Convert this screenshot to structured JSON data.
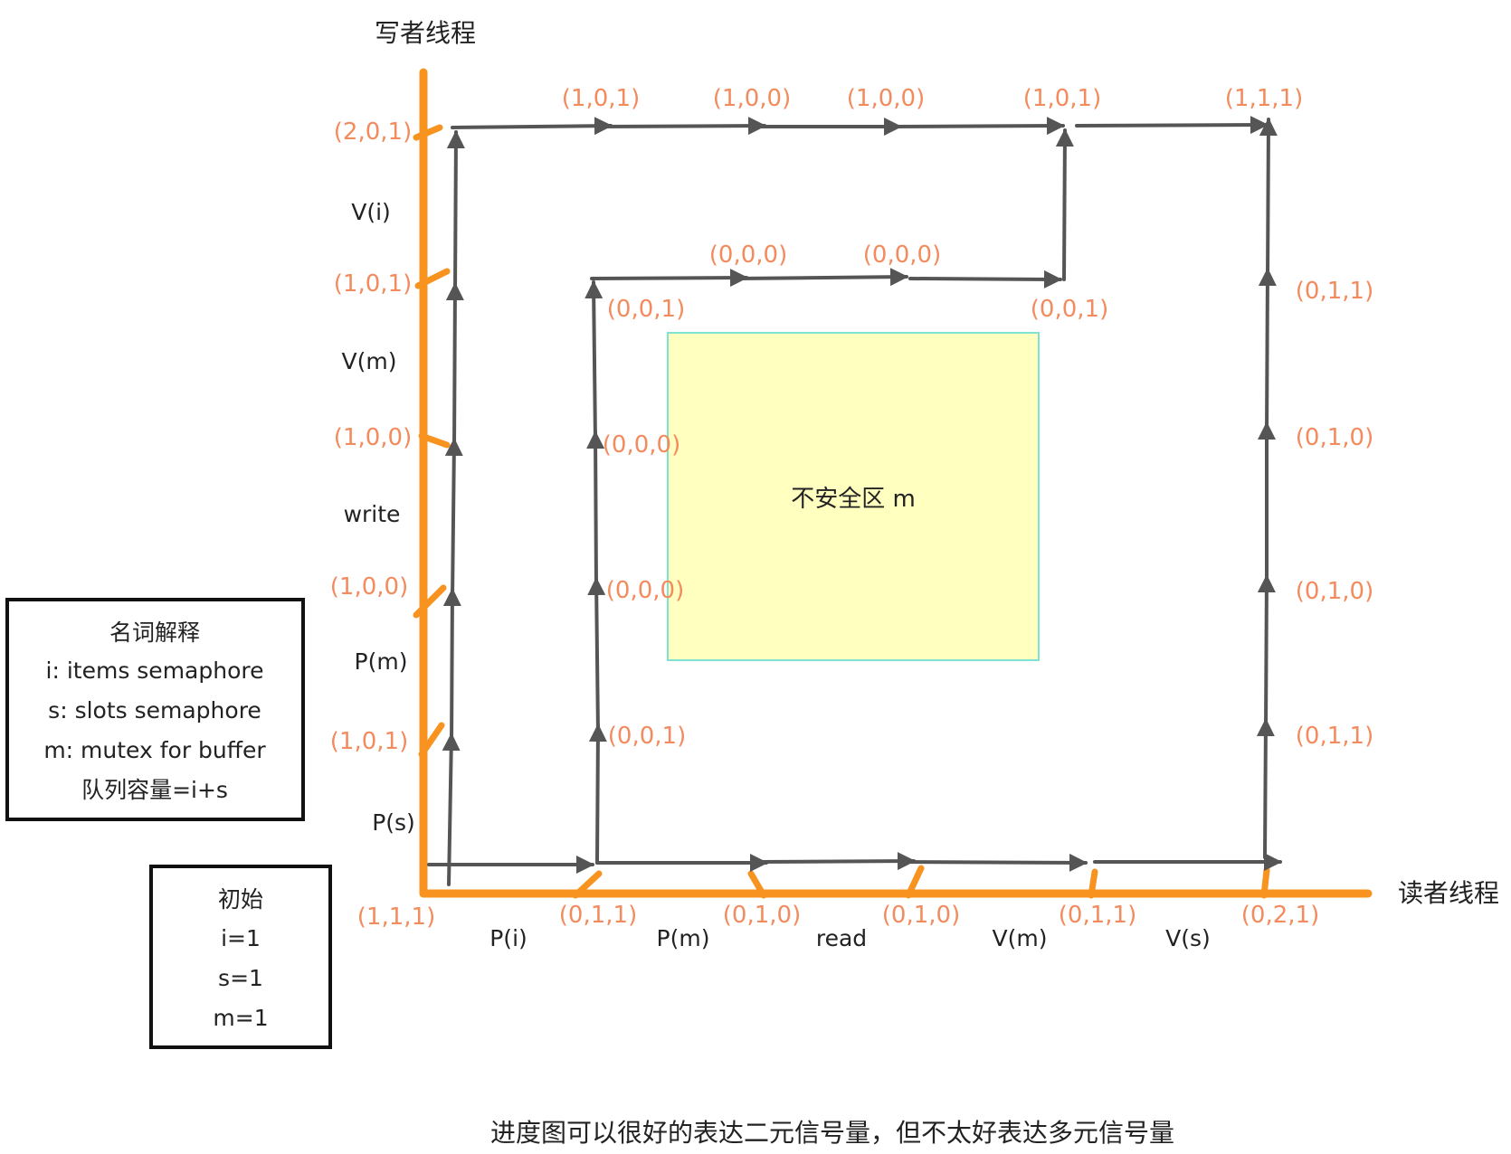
{
  "axes": {
    "writer_title": "写者线程",
    "reader_title": "读者线程",
    "writer_ops": [
      "P(s)",
      "P(m)",
      "write",
      "V(m)",
      "V(i)"
    ],
    "reader_ops": [
      "P(i)",
      "P(m)",
      "read",
      "V(m)",
      "V(s)"
    ]
  },
  "writer_axis_states": [
    "(1,0,1)",
    "(1,0,0)",
    "(1,0,0)",
    "(1,0,1)",
    "(2,0,1)"
  ],
  "reader_axis_states": [
    "(1,1,1)",
    "(0,1,1)",
    "(0,1,0)",
    "(0,1,0)",
    "(0,1,1)",
    "(0,2,1)"
  ],
  "path_states": {
    "top": [
      "(1,0,1)",
      "(1,0,0)",
      "(1,0,0)",
      "(1,0,1)",
      "(1,1,1)"
    ],
    "inner_top": [
      "(0,0,0)",
      "(0,0,0)"
    ],
    "inner_corners": [
      "(0,0,1)",
      "(0,0,1)"
    ],
    "inner_left": [
      "(0,0,0)",
      "(0,0,0)",
      "(0,0,1)"
    ],
    "right": [
      "(0,1,1)",
      "(0,1,0)",
      "(0,1,0)",
      "(0,1,1)"
    ]
  },
  "unsafe_zone": {
    "label": "不安全区 m",
    "fill": "#ffffc0",
    "border": "#7fe3d3"
  },
  "glossary": {
    "title": "名词解释",
    "lines": [
      "i: items semaphore",
      "s: slots semaphore",
      "m: mutex for buffer",
      "队列容量=i+s"
    ]
  },
  "initial": {
    "title": "初始",
    "lines": [
      "i=1",
      "s=1",
      "m=1"
    ]
  },
  "caption": "进度图可以很好的表达二元信号量，但不太好表达多元信号量",
  "colors": {
    "axis": "#f7931e",
    "arrow": "#555555",
    "state": "#f28b5e"
  }
}
